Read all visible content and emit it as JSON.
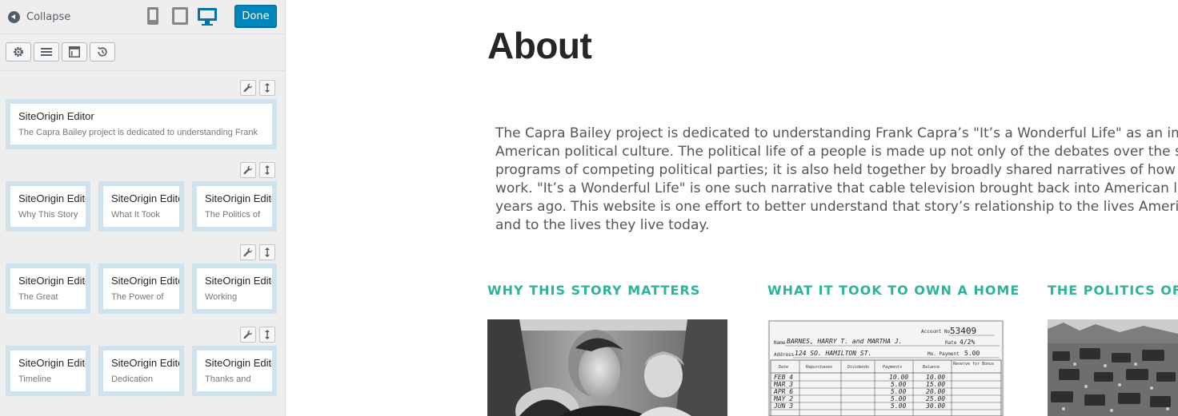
{
  "sidebar": {
    "collapse_label": "Collapse",
    "done_label": "Done",
    "devices": [
      "mobile-icon",
      "tablet-icon",
      "desktop-icon"
    ],
    "active_device": "desktop",
    "accent_color": "#0085ba",
    "toolbar_icons": [
      "gear-icon",
      "list-icon",
      "layout-icon",
      "history-icon"
    ],
    "rows": [
      {
        "widgets": [
          {
            "title": "SiteOrigin Editor",
            "desc": "The Capra Bailey project is dedicated to understanding Frank"
          }
        ]
      },
      {
        "widgets": [
          {
            "title": "SiteOrigin Editor",
            "desc": "Why This Story"
          },
          {
            "title": "SiteOrigin Editor",
            "desc": "What It Took"
          },
          {
            "title": "SiteOrigin Editor",
            "desc": "The Politics of"
          }
        ]
      },
      {
        "widgets": [
          {
            "title": "SiteOrigin Editor",
            "desc": "The Great"
          },
          {
            "title": "SiteOrigin Editor",
            "desc": "The Power of"
          },
          {
            "title": "SiteOrigin Editor",
            "desc": "Working"
          }
        ]
      },
      {
        "widgets": [
          {
            "title": "SiteOrigin Editor",
            "desc": "Timeline"
          },
          {
            "title": "SiteOrigin Editor",
            "desc": "Dedication"
          },
          {
            "title": "SiteOrigin Editor",
            "desc": "Thanks and"
          }
        ]
      }
    ]
  },
  "preview": {
    "heading": "About",
    "intro_lines": [
      "The Capra Bailey project is dedicated to understanding Frank Capra’s \"It’s a Wonderful Life\" as an impo",
      "American political culture. The political life of a people is made up not only of the debates over the spec",
      "programs of competing political parties; it is also held together by broadly shared narratives of how the",
      "work.  \"It’s a Wonderful Life\" is one such narrative that cable television brought back into American life",
      "years ago. This website is one effort to better understand that story’s relationship to the lives America",
      "and to the lives they live today."
    ],
    "columns": [
      {
        "heading": "WHY THIS STORY MATTERS"
      },
      {
        "heading": "WHAT IT TOOK TO OWN A HOME"
      },
      {
        "heading": "THE POLITICS OF P"
      }
    ],
    "ledger": {
      "account_no": "53409",
      "name": "BARNES, HARRY T. and MARTHA J.",
      "address": "124 SO. HAMILTON ST.",
      "rate": "4/2%",
      "payment": "5.00",
      "headers": [
        "Date",
        "Repurchases",
        "Dividends",
        "Payments",
        "Balance",
        "Reserve for Bonus"
      ],
      "rows": [
        {
          "date": "FEB 4",
          "payment": "10.00",
          "balance": "10.00"
        },
        {
          "date": "MAR 3",
          "payment": "5.00",
          "balance": "15.00"
        },
        {
          "date": "APR 6",
          "payment": "5.00",
          "balance": "20.00"
        },
        {
          "date": "MAY 2",
          "payment": "5.00",
          "balance": "25.00"
        },
        {
          "date": "JUN 3",
          "payment": "5.00",
          "balance": "30.00"
        }
      ]
    },
    "heading_color": "#262626",
    "column_heading_color": "#2db398"
  }
}
